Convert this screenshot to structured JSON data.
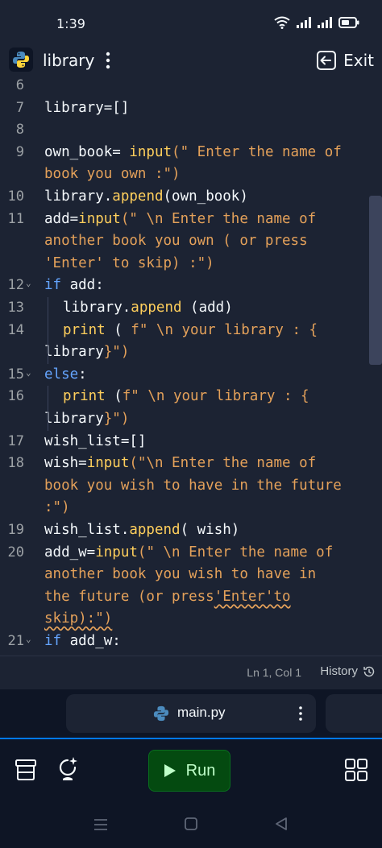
{
  "status_bar": {
    "time": "1:39"
  },
  "header": {
    "repl_name": "library",
    "exit_label": "Exit"
  },
  "editor": {
    "lines": [
      {
        "n": "6",
        "segments": []
      },
      {
        "n": "7",
        "segments": [
          {
            "t": "library=[]",
            "c": "def"
          }
        ]
      },
      {
        "n": "8",
        "segments": []
      },
      {
        "n": "9",
        "segments": [
          {
            "t": "own_book= ",
            "c": "def"
          },
          {
            "t": "input",
            "c": "fn"
          },
          {
            "t": "(\" Enter the name of",
            "c": "str"
          }
        ]
      },
      {
        "n": "",
        "segments": [
          {
            "t": "book you own :\")",
            "c": "str"
          }
        ]
      },
      {
        "n": "10",
        "segments": [
          {
            "t": "library.",
            "c": "def"
          },
          {
            "t": "append",
            "c": "fn"
          },
          {
            "t": "(own_book)",
            "c": "def"
          }
        ]
      },
      {
        "n": "11",
        "segments": [
          {
            "t": "add=",
            "c": "def"
          },
          {
            "t": "input",
            "c": "fn"
          },
          {
            "t": "(\" \\n Enter the name of",
            "c": "str"
          }
        ]
      },
      {
        "n": "",
        "segments": [
          {
            "t": "another book you own ( or press",
            "c": "str"
          }
        ]
      },
      {
        "n": "",
        "segments": [
          {
            "t": "'Enter' to skip) :\")",
            "c": "str"
          }
        ]
      },
      {
        "n": "12",
        "fold": true,
        "segments": [
          {
            "t": "if",
            "c": "kw"
          },
          {
            "t": " add:",
            "c": "def"
          }
        ]
      },
      {
        "n": "13",
        "indent": true,
        "segments": [
          {
            "t": "library.",
            "c": "def"
          },
          {
            "t": "append",
            "c": "fn"
          },
          {
            "t": " (add)",
            "c": "def"
          }
        ]
      },
      {
        "n": "14",
        "indent": true,
        "segments": [
          {
            "t": "print",
            "c": "fn"
          },
          {
            "t": " ( ",
            "c": "def"
          },
          {
            "t": "f\" \\n your library : {",
            "c": "str"
          }
        ]
      },
      {
        "n": "",
        "segments": [
          {
            "t": "library",
            "c": "def"
          },
          {
            "t": "}\")",
            "c": "str"
          }
        ]
      },
      {
        "n": "15",
        "fold": true,
        "segments": [
          {
            "t": "else",
            "c": "kw"
          },
          {
            "t": ":",
            "c": "def"
          }
        ]
      },
      {
        "n": "16",
        "indent": true,
        "segments": [
          {
            "t": "print",
            "c": "fn"
          },
          {
            "t": " (",
            "c": "def"
          },
          {
            "t": "f\" \\n your library : {",
            "c": "str"
          }
        ]
      },
      {
        "n": "",
        "segments": [
          {
            "t": "library",
            "c": "def"
          },
          {
            "t": "}\")",
            "c": "str"
          }
        ]
      },
      {
        "n": "17",
        "segments": [
          {
            "t": "wish_list=[]",
            "c": "def"
          }
        ]
      },
      {
        "n": "18",
        "segments": [
          {
            "t": "wish=",
            "c": "def"
          },
          {
            "t": "input",
            "c": "fn"
          },
          {
            "t": "(\"\\n Enter the name of",
            "c": "str"
          }
        ]
      },
      {
        "n": "",
        "segments": [
          {
            "t": "book you wish to have in the future",
            "c": "str"
          }
        ]
      },
      {
        "n": "",
        "segments": [
          {
            "t": ":\")",
            "c": "str"
          }
        ]
      },
      {
        "n": "19",
        "segments": [
          {
            "t": "wish_list.",
            "c": "def"
          },
          {
            "t": "append",
            "c": "fn"
          },
          {
            "t": "( wish)",
            "c": "def"
          }
        ]
      },
      {
        "n": "20",
        "segments": [
          {
            "t": "add_w=",
            "c": "def"
          },
          {
            "t": "input",
            "c": "fn"
          },
          {
            "t": "(\" \\n Enter the name of",
            "c": "str"
          }
        ]
      },
      {
        "n": "",
        "segments": [
          {
            "t": "another book you wish to have in",
            "c": "str"
          }
        ]
      },
      {
        "n": "",
        "segments": [
          {
            "t": "the future (or press",
            "c": "str"
          },
          {
            "t": "'Enter'to",
            "c": "str",
            "squig": true
          }
        ]
      },
      {
        "n": "",
        "segments": [
          {
            "t": "skip):\")",
            "c": "str",
            "squig": true
          }
        ]
      },
      {
        "n": "21",
        "fold": true,
        "segments": [
          {
            "t": "if",
            "c": "kw"
          },
          {
            "t": " add_w:",
            "c": "def"
          }
        ]
      }
    ]
  },
  "editor_footer": {
    "cursor": "Ln 1, Col 1",
    "history_label": "History"
  },
  "file_tab": {
    "name": "main.py"
  },
  "toolbar": {
    "run_label": "Run"
  },
  "colors": {
    "background": "#1c2333",
    "accent": "#0079f2",
    "run_green": "#044a10"
  }
}
